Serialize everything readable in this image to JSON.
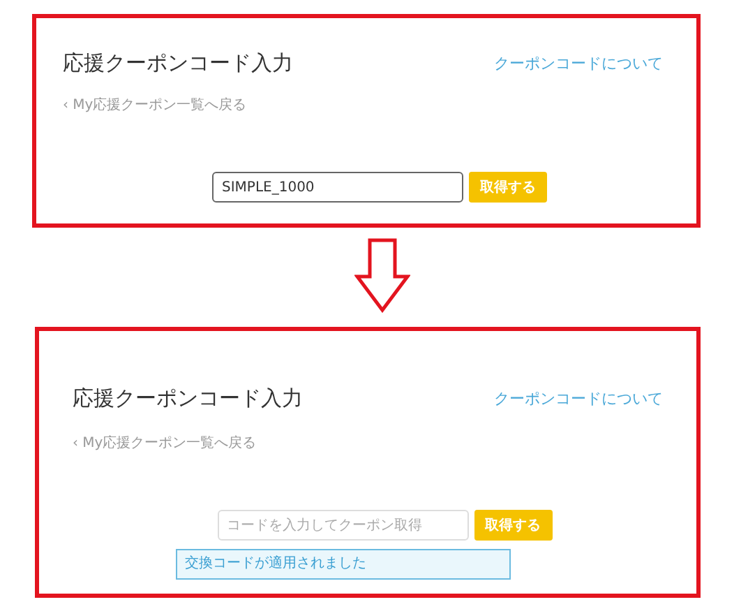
{
  "panels": [
    {
      "title": "応援クーポンコード入力",
      "help_link": "クーポンコードについて",
      "back_link": "‹ My応援クーポン一覧へ戻る",
      "code_field": {
        "value": "SIMPLE_1000"
      },
      "submit_button": "取得する"
    },
    {
      "title": "応援クーポンコード入力",
      "help_link": "クーポンコードについて",
      "back_link": "‹ My応援クーポン一覧へ戻る",
      "code_field": {
        "placeholder": "コードを入力してクーポン取得"
      },
      "submit_button": "取得する",
      "message": "交換コードが適用されました"
    }
  ]
}
